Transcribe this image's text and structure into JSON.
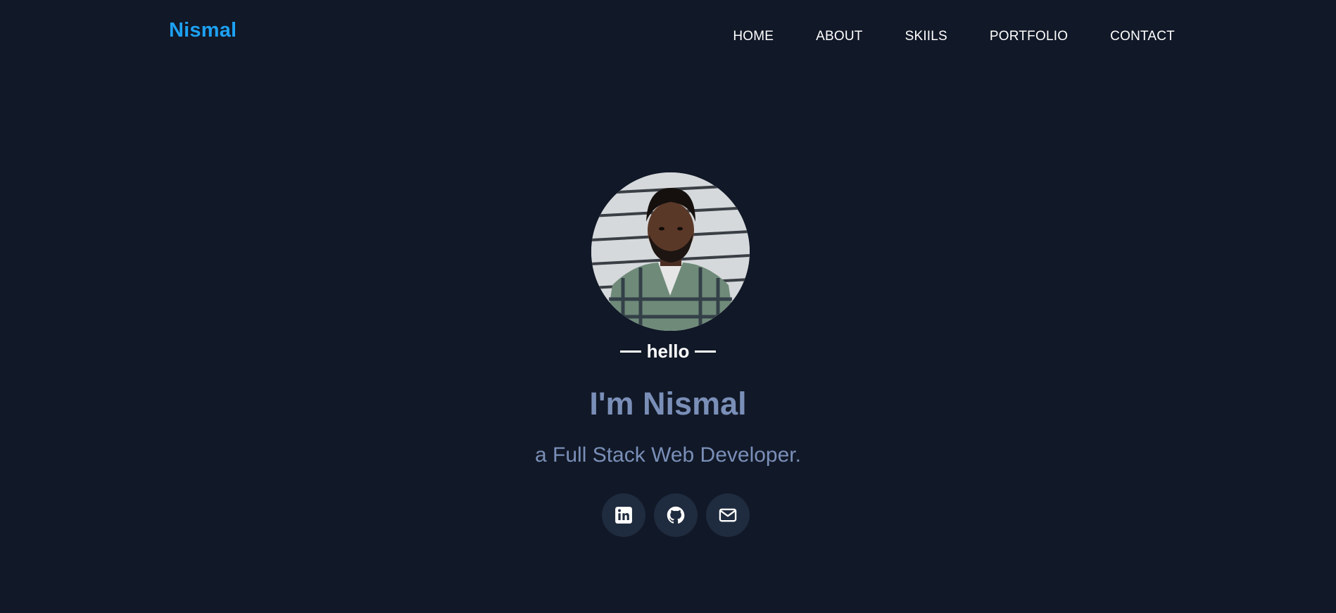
{
  "header": {
    "logo": "Nismal",
    "nav": [
      {
        "label": "HOME"
      },
      {
        "label": "ABOUT"
      },
      {
        "label": "SKIILS"
      },
      {
        "label": "PORTFOLIO"
      },
      {
        "label": "CONTACT"
      }
    ]
  },
  "hero": {
    "avatar_icon": "profile-photo",
    "greeting": "hello",
    "headline": "I'm Nismal",
    "subline": "a Full Stack Web Developer.",
    "socials": [
      {
        "icon": "linkedin-icon"
      },
      {
        "icon": "github-icon"
      },
      {
        "icon": "mail-icon"
      }
    ]
  },
  "colors": {
    "background": "#111827",
    "accent": "#1da1f2",
    "headline": "#7a8fb8",
    "social_bg": "#1f2b3e"
  }
}
